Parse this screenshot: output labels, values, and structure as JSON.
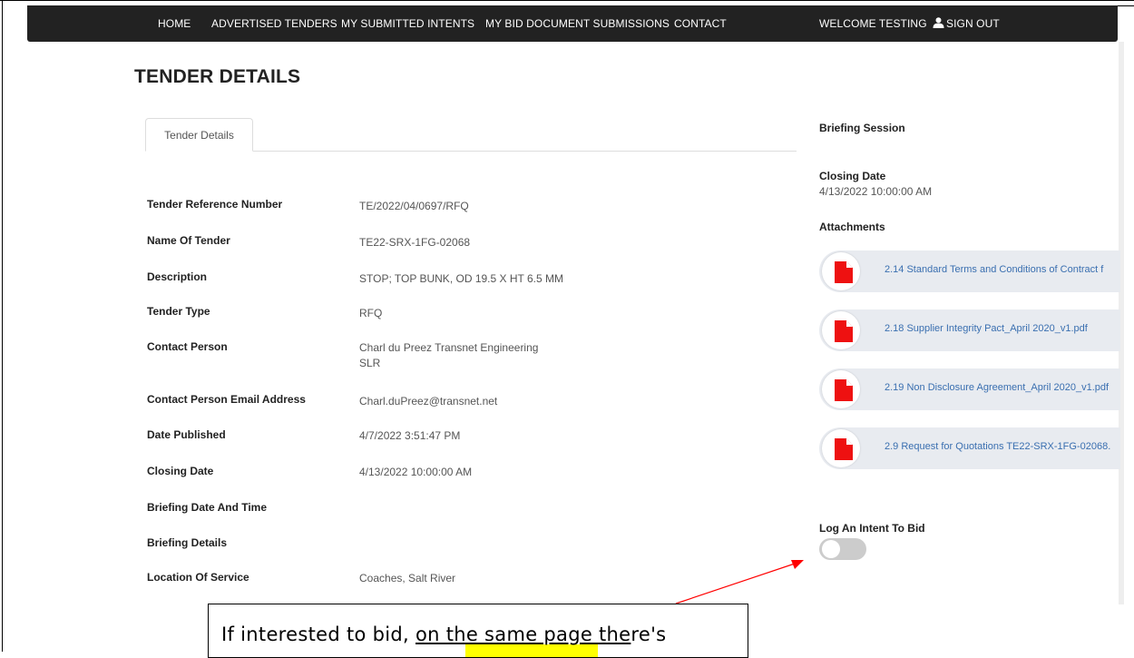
{
  "nav": {
    "home": "HOME",
    "advertised_tenders": "ADVERTISED TENDERS",
    "my_submitted_intents": "MY SUBMITTED INTENTS",
    "my_bid_document_submissions": "MY BID DOCUMENT SUBMISSIONS",
    "contact": "CONTACT",
    "welcome": "WELCOME TESTING",
    "sign_out": "SIGN OUT",
    "user_icon": "user-icon",
    "background_color": "#222222"
  },
  "page": {
    "title": "TENDER DETAILS",
    "tab_label": "Tender Details"
  },
  "details": [
    {
      "label": "Tender Reference Number",
      "value": "TE/2022/04/0697/RFQ"
    },
    {
      "label": "Name Of Tender",
      "value": "TE22-SRX-1FG-02068"
    },
    {
      "label": "Description",
      "value": "STOP; TOP BUNK, OD 19.5 X HT 6.5 MM"
    },
    {
      "label": "Tender Type",
      "value": "RFQ"
    },
    {
      "label": "Contact Person",
      "value": "Charl du Preez Transnet Engineering",
      "value_line2": "SLR"
    },
    {
      "label": "Contact Person Email Address",
      "value": "Charl.duPreez@transnet.net"
    },
    {
      "label": "Date Published",
      "value": "4/7/2022 3:51:47 PM"
    },
    {
      "label": "Closing Date",
      "value": "4/13/2022 10:00:00 AM"
    },
    {
      "label": "Briefing Date And Time",
      "value": ""
    },
    {
      "label": "Briefing Details",
      "value": ""
    },
    {
      "label": "Location Of Service",
      "value": "Coaches, Salt River"
    }
  ],
  "sidebar": {
    "briefing_session": "Briefing Session",
    "closing_date_label": "Closing Date",
    "closing_date_value": "4/13/2022 10:00:00 AM",
    "attachments_label": "Attachments",
    "attachments": [
      {
        "name": "2.14 Standard Terms and Conditions of Contract f",
        "icon": "pdf-icon"
      },
      {
        "name": "2.18 Supplier Integrity Pact_April 2020_v1.pdf",
        "icon": "pdf-icon"
      },
      {
        "name": "2.19 Non Disclosure Agreement_April 2020_v1.pdf",
        "icon": "pdf-icon"
      },
      {
        "name": "2.9 Request for Quotations TE22-SRX-1FG-02068.",
        "icon": "pdf-icon"
      }
    ],
    "intent_label": "Log An Intent To Bid",
    "intent_toggle_on": false,
    "pdf_color": "#ee1111",
    "link_color": "#3a6fb0"
  },
  "callout": {
    "part1": "If interested to bid, ",
    "part2": "on the same page the",
    "part3": "re's",
    "highlight_color": "#ffff00",
    "arrow_color": "#ff0000"
  }
}
